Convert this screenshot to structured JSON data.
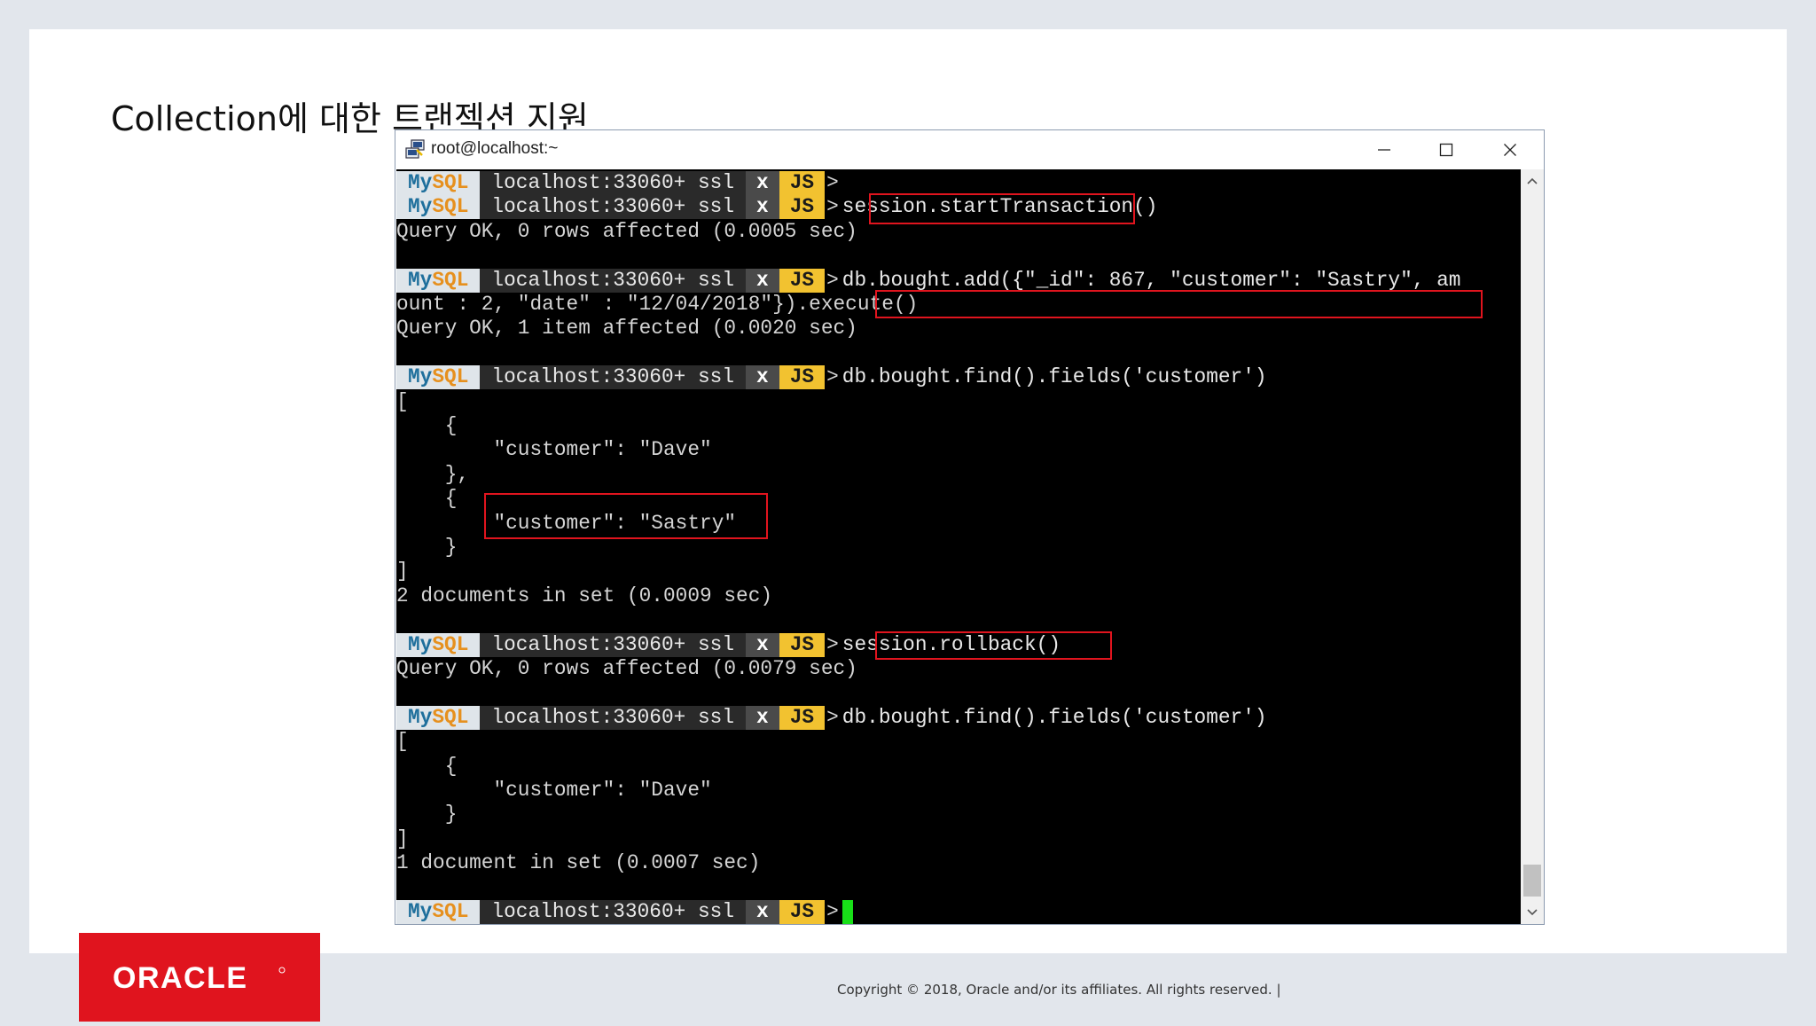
{
  "slide": {
    "title": "Collection에 대한 트랜젝션 지원",
    "copyright": "Copyright © 2018, Oracle and/or its affiliates. All rights reserved.  |",
    "logo_text": "ORACLE"
  },
  "window": {
    "title": "root@localhost:~"
  },
  "prompt": {
    "my": "My",
    "sql": "SQL",
    "host": "localhost:33060+ ssl",
    "mode_x": "x",
    "mode_js": "JS",
    "arrow": ">"
  },
  "terminal": {
    "lines": [
      {
        "type": "prompt",
        "cmd": ""
      },
      {
        "type": "prompt",
        "cmd": "session.startTransaction()"
      },
      {
        "type": "text",
        "text": "Query OK, 0 rows affected (0.0005 sec)"
      },
      {
        "type": "text",
        "text": ""
      },
      {
        "type": "prompt",
        "cmd": "db.bought.add({\"_id\": 867, \"customer\": \"Sastry\", am"
      },
      {
        "type": "text",
        "text": "ount : 2, \"date\" : \"12/04/2018\"}).execute()"
      },
      {
        "type": "text",
        "text": "Query OK, 1 item affected (0.0020 sec)"
      },
      {
        "type": "text",
        "text": ""
      },
      {
        "type": "prompt",
        "cmd": "db.bought.find().fields('customer')"
      },
      {
        "type": "text",
        "text": "["
      },
      {
        "type": "text",
        "text": "    {"
      },
      {
        "type": "text",
        "text": "        \"customer\": \"Dave\""
      },
      {
        "type": "text",
        "text": "    },"
      },
      {
        "type": "text",
        "text": "    {"
      },
      {
        "type": "text",
        "text": "        \"customer\": \"Sastry\""
      },
      {
        "type": "text",
        "text": "    }"
      },
      {
        "type": "text",
        "text": "]"
      },
      {
        "type": "text",
        "text": "2 documents in set (0.0009 sec)"
      },
      {
        "type": "text",
        "text": ""
      },
      {
        "type": "prompt",
        "cmd": "session.rollback()"
      },
      {
        "type": "text",
        "text": "Query OK, 0 rows affected (0.0079 sec)"
      },
      {
        "type": "text",
        "text": ""
      },
      {
        "type": "prompt",
        "cmd": "db.bought.find().fields('customer')"
      },
      {
        "type": "text",
        "text": "["
      },
      {
        "type": "text",
        "text": "    {"
      },
      {
        "type": "text",
        "text": "        \"customer\": \"Dave\""
      },
      {
        "type": "text",
        "text": "    }"
      },
      {
        "type": "text",
        "text": "]"
      },
      {
        "type": "text",
        "text": "1 document in set (0.0007 sec)"
      },
      {
        "type": "text",
        "text": ""
      },
      {
        "type": "prompt",
        "cmd": "",
        "cursor": true
      }
    ]
  },
  "colors": {
    "highlight": "#e0141e",
    "cursor": "#18e018",
    "oracle_red": "#e0141e"
  }
}
